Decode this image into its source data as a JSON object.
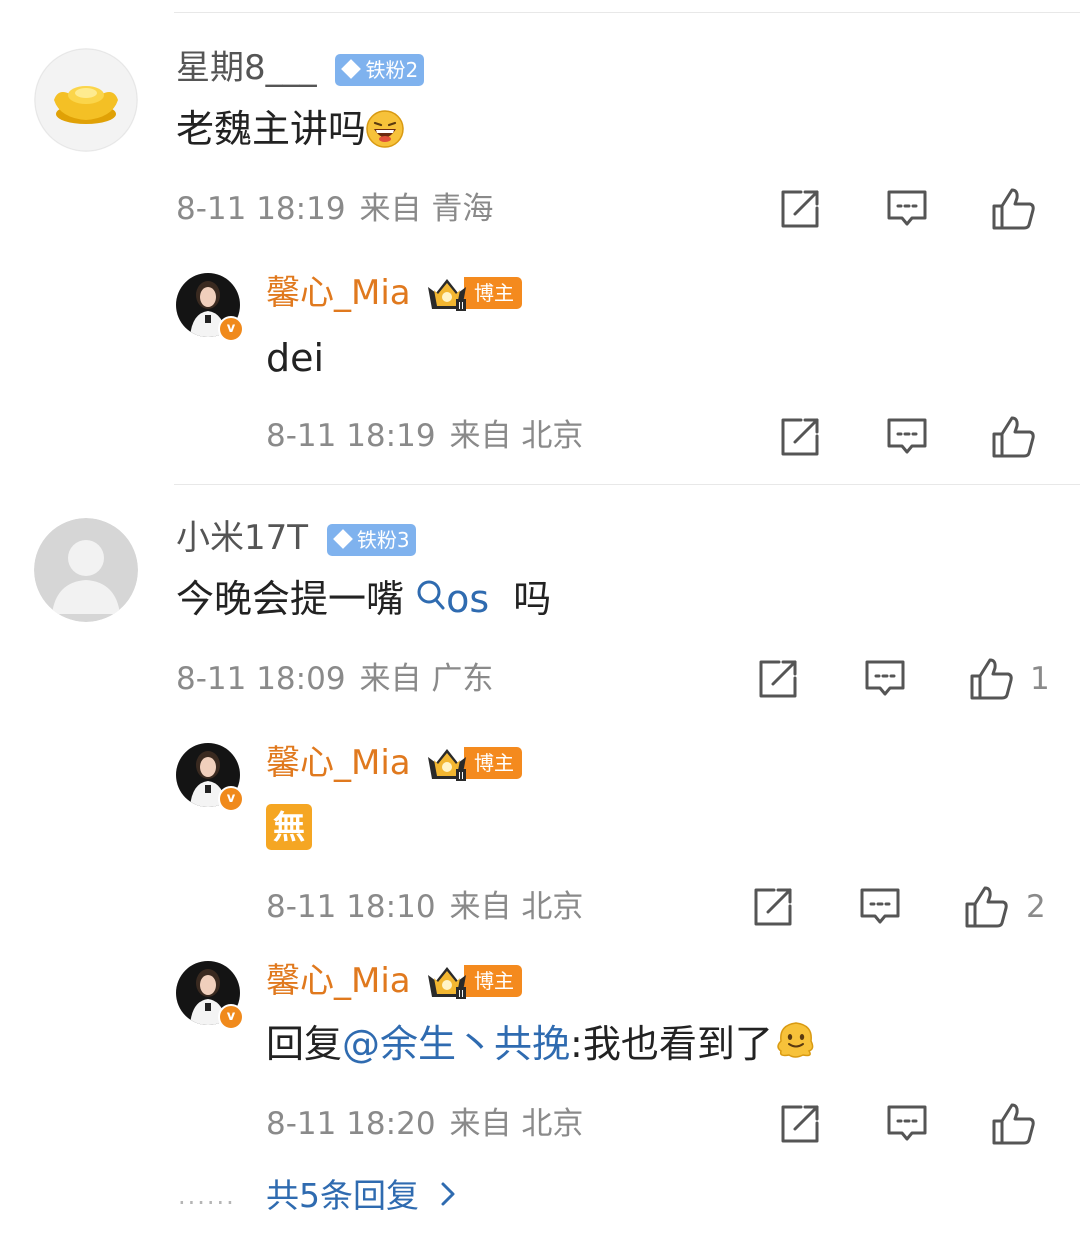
{
  "comments": [
    {
      "username": "星期8___",
      "fan_badge": "铁粉2",
      "text": "老魏主讲吗",
      "emoji": "laughing-emoji",
      "time": "8-11 18:19",
      "from_label": "来自",
      "location": "青海",
      "likes": "",
      "replies": [
        {
          "username": "馨心_Mia",
          "badge": "博主",
          "text": "dei",
          "time": "8-11 18:19",
          "from_label": "来自",
          "location": "北京",
          "likes": ""
        }
      ]
    },
    {
      "username": "小米17T",
      "fan_badge": "铁粉3",
      "text_before": "今晚会提一嘴 ",
      "search_keyword": "os",
      "text_after": "  吗",
      "time": "8-11 18:09",
      "from_label": "来自",
      "location": "广东",
      "likes": "1",
      "replies": [
        {
          "username": "馨心_Mia",
          "badge": "博主",
          "sticker": "無",
          "time": "8-11 18:10",
          "from_label": "来自",
          "location": "北京",
          "likes": "2"
        },
        {
          "username": "馨心_Mia",
          "badge": "博主",
          "reply_prefix": "回复",
          "mention": "@余生丶共挽",
          "text_after": ":我也看到了",
          "emoji": "melting-face-emoji",
          "time": "8-11 18:20",
          "from_label": "来自",
          "location": "北京",
          "likes": ""
        }
      ],
      "more_dots": "......",
      "more_replies": "共5条回复"
    }
  ],
  "colors": {
    "blogger_name": "#e0791e",
    "link": "#2f6bb0",
    "fan_badge": "#7fb2ee",
    "blogger_badge": "#f48a1e",
    "meta": "#8a8a8a"
  }
}
